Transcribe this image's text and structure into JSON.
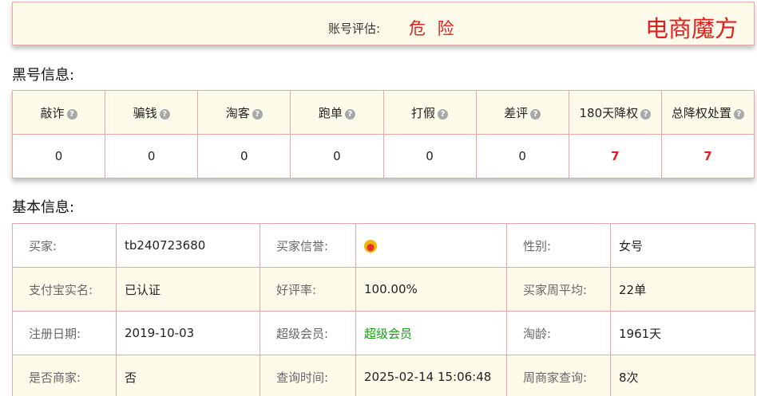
{
  "account": {
    "label": "账号评估:",
    "value": "危 险",
    "brand": "电商魔方"
  },
  "blacklist": {
    "title": "黑号信息:",
    "headers": [
      "敲诈",
      "骗钱",
      "淘客",
      "跑单",
      "打假",
      "差评",
      "180天降权",
      "总降权处置"
    ],
    "values": [
      "0",
      "0",
      "0",
      "0",
      "0",
      "0",
      "7",
      "7"
    ],
    "colors": {
      "highlight": "#e02020",
      "help_icon": "#a8a8a8"
    }
  },
  "basic": {
    "title": "基本信息:",
    "rows": [
      [
        {
          "k": "买家:",
          "v": "tb240723680"
        },
        {
          "k": "买家信誉:",
          "v": ""
        },
        {
          "k": "性别:",
          "v": "女号"
        }
      ],
      [
        {
          "k": "支付宝实名:",
          "v": "已认证"
        },
        {
          "k": "好评率:",
          "v": "100.00%"
        },
        {
          "k": "买家周平均:",
          "v": "22单"
        }
      ],
      [
        {
          "k": "注册日期:",
          "v": "2019-10-03"
        },
        {
          "k": "超级会员:",
          "v": "超级会员"
        },
        {
          "k": "淘龄:",
          "v": "1961天"
        }
      ],
      [
        {
          "k": "是否商家:",
          "v": "否"
        },
        {
          "k": "查询时间:",
          "v": "2025-02-14 15:06:48"
        },
        {
          "k": "周商家查询:",
          "v": "8次"
        }
      ]
    ],
    "credit_icon": "crown-icon",
    "colors": {
      "vip": "#1a9b1a"
    }
  }
}
